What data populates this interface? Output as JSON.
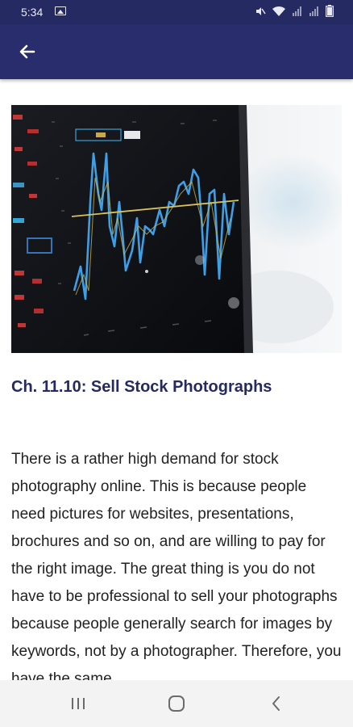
{
  "status_bar": {
    "time": "5:34",
    "icons": [
      "gallery-icon",
      "mute-icon",
      "wifi-icon",
      "signal-icon",
      "signal-icon",
      "battery-icon"
    ]
  },
  "app_bar": {
    "back_icon": "back-arrow-icon",
    "color": "#2a2d6d"
  },
  "hero_image": {
    "description_icon": "stock-chart-image"
  },
  "chapter": {
    "title": "Ch. 11.10: Sell Stock Photographs",
    "title_color": "#262a63"
  },
  "article": {
    "body": "There is a rather high demand for stock photography online. This is because people need pictures for websites, presentations, brochures and so on, and are willing to pay for the right image. The great thing is you do not have to be professional to sell your photographs because people generally search for images by keywords, not by a photographer. Therefore, you have the same"
  },
  "nav_bar": {
    "recents_icon": "recents-icon",
    "home_icon": "home-icon",
    "back_icon": "back-icon"
  }
}
